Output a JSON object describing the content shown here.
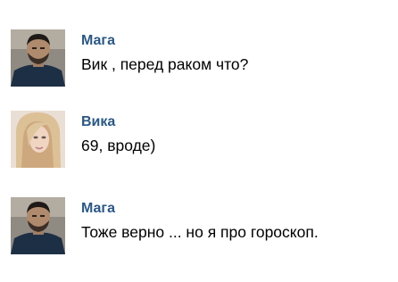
{
  "messages": [
    {
      "author": "Мага",
      "text": "Вик , перед раком что?",
      "avatar_icon": "male-user-photo"
    },
    {
      "author": "Вика",
      "text": "69, вроде)",
      "avatar_icon": "female-user-photo"
    },
    {
      "author": "Мага",
      "text": "Тоже верно ... но я про гороскоп.",
      "avatar_icon": "male-user-photo"
    }
  ],
  "colors": {
    "author_name": "#2a5885",
    "message_text": "#000000",
    "background": "#ffffff"
  }
}
